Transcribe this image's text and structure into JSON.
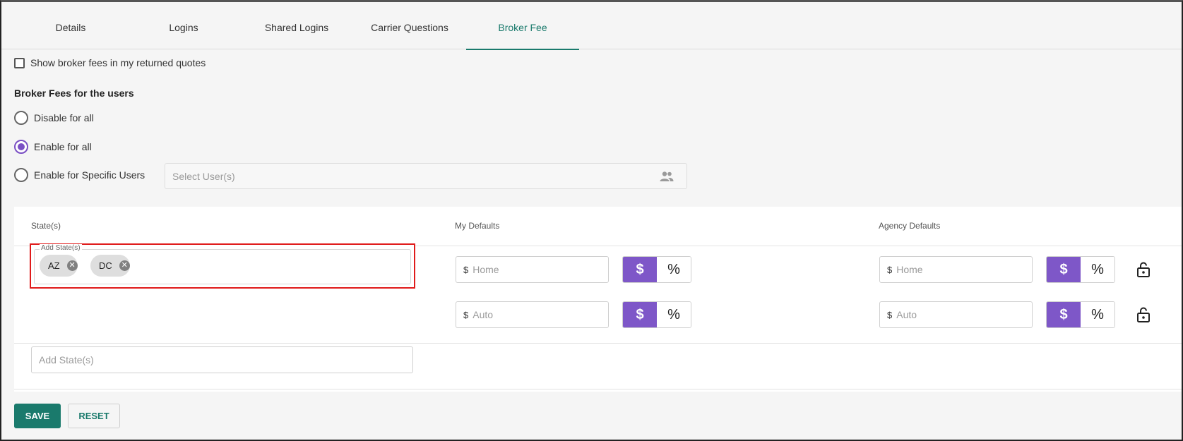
{
  "tabs": [
    {
      "label": "Details",
      "active": false
    },
    {
      "label": "Logins",
      "active": false
    },
    {
      "label": "Shared Logins",
      "active": false
    },
    {
      "label": "Carrier Questions",
      "active": false
    },
    {
      "label": "Broker Fee",
      "active": true
    }
  ],
  "show_fees_checkbox": {
    "label": "Show broker fees in my returned quotes",
    "checked": false
  },
  "broker_fees": {
    "title": "Broker Fees for the users",
    "options": [
      {
        "label": "Disable for all",
        "selected": false
      },
      {
        "label": "Enable for all",
        "selected": true
      },
      {
        "label": "Enable for Specific Users",
        "selected": false
      }
    ],
    "user_select_placeholder": "Select User(s)"
  },
  "table": {
    "headers": {
      "states": "State(s)",
      "my_defaults": "My Defaults",
      "agency_defaults": "Agency Defaults"
    },
    "state_field_label": "Add State(s)",
    "chips": [
      "AZ",
      "DC"
    ],
    "currency_symbol": "$",
    "rows": [
      {
        "placeholder": "Home"
      },
      {
        "placeholder": "Auto"
      }
    ],
    "toggle": {
      "dollar": "$",
      "percent": "%"
    },
    "add_state_placeholder": "Add State(s)"
  },
  "buttons": {
    "save": "SAVE",
    "reset": "RESET"
  },
  "colors": {
    "accent": "#1a7a6c",
    "purple": "#7e57c8",
    "highlight": "#e01b1b"
  }
}
